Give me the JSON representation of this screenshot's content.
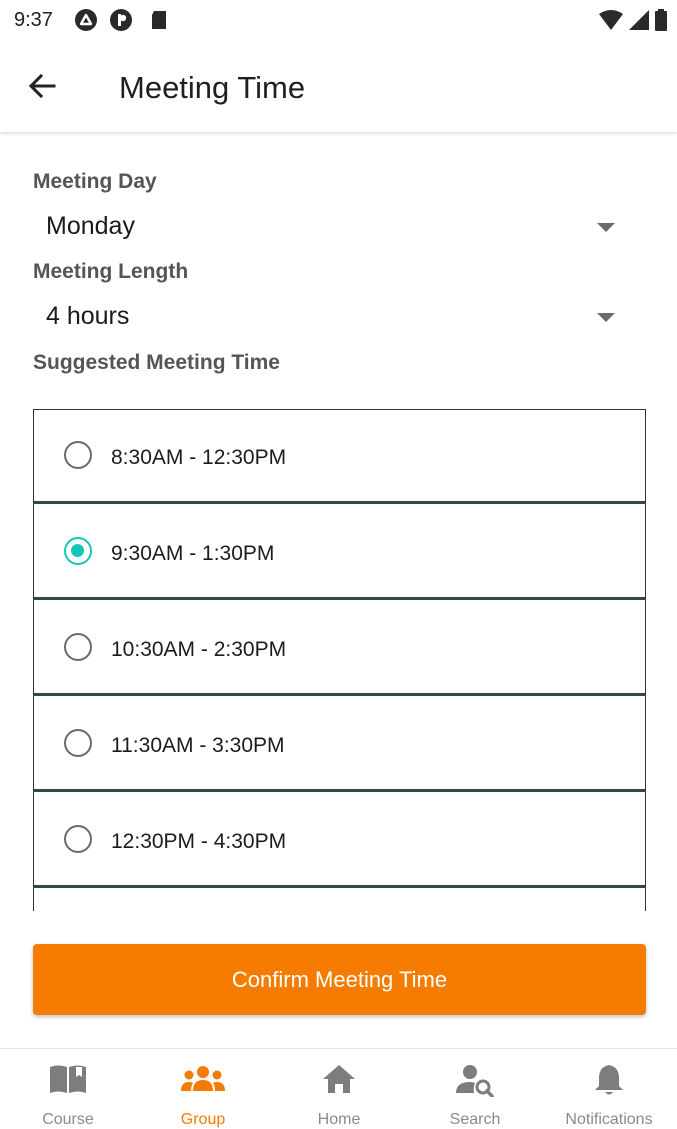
{
  "status_bar": {
    "time": "9:37"
  },
  "app_bar": {
    "title": "Meeting Time"
  },
  "form": {
    "meeting_day": {
      "label": "Meeting Day",
      "value": "Monday"
    },
    "meeting_length": {
      "label": "Meeting Length",
      "value": "4 hours"
    },
    "suggested_label": "Suggested Meeting Time"
  },
  "times": [
    {
      "label": "8:30AM - 12:30PM",
      "selected": false
    },
    {
      "label": "9:30AM - 1:30PM",
      "selected": true
    },
    {
      "label": "10:30AM - 2:30PM",
      "selected": false
    },
    {
      "label": "11:30AM - 3:30PM",
      "selected": false
    },
    {
      "label": "12:30PM - 4:30PM",
      "selected": false
    }
  ],
  "confirm_label": "Confirm Meeting Time",
  "bottom_nav": [
    {
      "label": "Course",
      "icon": "book-icon",
      "active": false
    },
    {
      "label": "Group",
      "icon": "group-icon",
      "active": true
    },
    {
      "label": "Home",
      "icon": "home-icon",
      "active": false
    },
    {
      "label": "Search",
      "icon": "person-search-icon",
      "active": false
    },
    {
      "label": "Notifications",
      "icon": "bell-icon",
      "active": false
    }
  ],
  "colors": {
    "accent": "#f57c00",
    "radio_selected": "#14c6b3",
    "divider": "#2c4a46"
  }
}
